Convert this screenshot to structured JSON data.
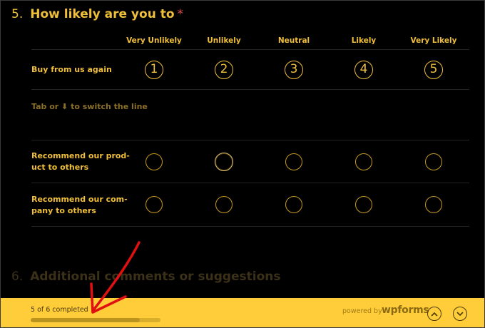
{
  "question": {
    "number": "5.",
    "text": "How likely are you to",
    "required_mark": "*"
  },
  "columns": [
    "Very Unlikely",
    "Unlikely",
    "Neutral",
    "Likely",
    "Very Likely"
  ],
  "rows": [
    {
      "label_lines": [
        "Buy from us again"
      ]
    },
    {
      "label_lines": [
        "Recommend our prod-",
        "uct to others"
      ]
    },
    {
      "label_lines": [
        "Recommend our com-",
        "pany to others"
      ]
    }
  ],
  "selected_numbers": [
    "1",
    "2",
    "3",
    "4",
    "5"
  ],
  "hint": {
    "pre": "Tab or",
    "post": "to switch the line",
    "icon": "arrow-down-icon"
  },
  "next_question": {
    "number": "6.",
    "text": "Additional comments or suggestions"
  },
  "footer": {
    "progress_text": "5 of 6 completed",
    "progress_fraction": 0.84,
    "powered_by": "powered by",
    "brand": "wpforms"
  },
  "colors": {
    "accent": "#f0bf3a",
    "footer_bg": "#ffcc3a",
    "annotation": "#e01010"
  }
}
